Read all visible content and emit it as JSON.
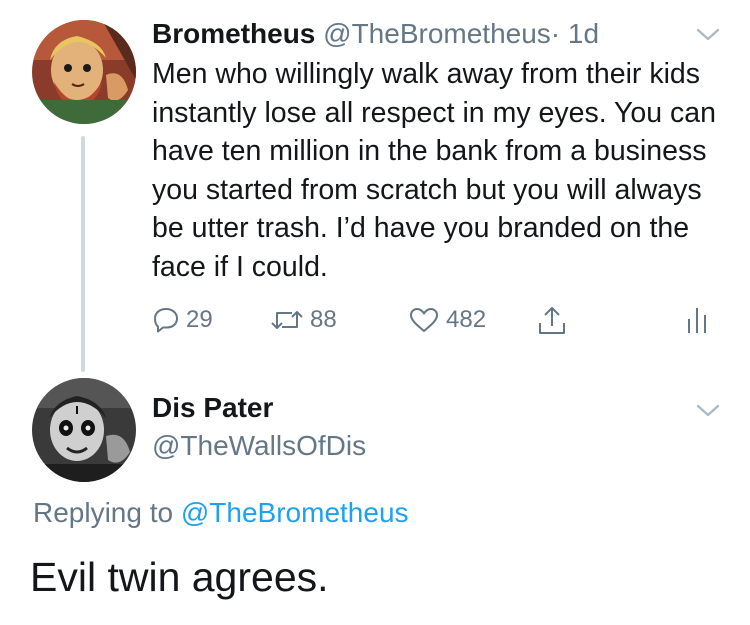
{
  "tweet": {
    "author": {
      "display_name": "Brometheus",
      "handle": "@TheBrometheus",
      "avatar_icon": "cartoon-bearded-man-avatar"
    },
    "separator": "·",
    "time": "1d",
    "text": "Men who willingly walk away from their kids instantly lose all respect in my eyes. You can have ten million in the bank from a business you started from scratch but you will always be utter trash. I’d have you branded on the face if I could.",
    "actions": {
      "replies": "29",
      "retweets": "88",
      "likes": "482"
    },
    "icons": {
      "reply": "reply-icon",
      "retweet": "retweet-icon",
      "like": "heart-icon",
      "share": "share-icon",
      "stats": "analytics-icon",
      "menu": "chevron-down-icon"
    }
  },
  "reply": {
    "author": {
      "display_name": "Dis Pater",
      "handle": "@TheWallsOfDis",
      "avatar_icon": "cartoon-grayscale-skull-face-avatar"
    },
    "replying_prefix": "Replying to",
    "replying_to": "@TheBrometheus",
    "text": "Evil twin agrees."
  },
  "colors": {
    "text_primary": "#14171a",
    "text_secondary": "#657786",
    "link": "#1da1f2",
    "thread_line": "#cfd9de"
  }
}
